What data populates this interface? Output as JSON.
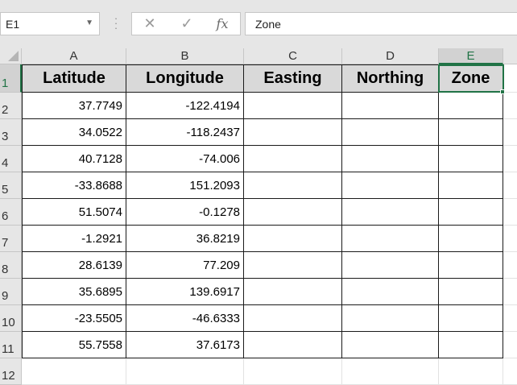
{
  "name_box": {
    "value": "E1"
  },
  "formula_bar": {
    "content": "Zone"
  },
  "icons": {
    "cancel": "x-icon",
    "enter": "checkmark-icon",
    "function": "fx-icon"
  },
  "accent_color": "#217346",
  "columns": [
    "A",
    "B",
    "C",
    "D",
    "E"
  ],
  "rows": [
    "1",
    "2",
    "3",
    "4",
    "5",
    "6",
    "7",
    "8",
    "9",
    "10",
    "11",
    "12"
  ],
  "sheet": {
    "headers": [
      "Latitude",
      "Longitude",
      "Easting",
      "Northing",
      "Zone"
    ],
    "data": [
      [
        "37.7749",
        "-122.4194"
      ],
      [
        "34.0522",
        "-118.2437"
      ],
      [
        "40.7128",
        "-74.006"
      ],
      [
        "-33.8688",
        "151.2093"
      ],
      [
        "51.5074",
        "-0.1278"
      ],
      [
        "-1.2921",
        "36.8219"
      ],
      [
        "28.6139",
        "77.209"
      ],
      [
        "35.6895",
        "139.6917"
      ],
      [
        "-23.5505",
        "-46.6333"
      ],
      [
        "55.7558",
        "37.6173"
      ]
    ]
  },
  "active_cell": "E1"
}
